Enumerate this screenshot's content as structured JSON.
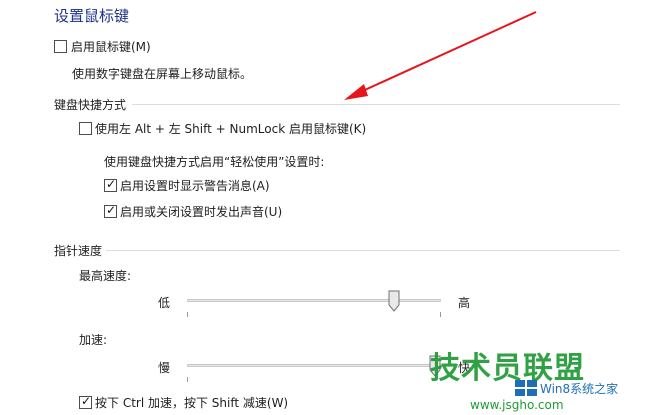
{
  "page": {
    "title": "设置鼠标键"
  },
  "mouse_keys": {
    "enable_label": "启用鼠标键(M)",
    "enable_checked": false,
    "description": "使用数字键盘在屏幕上移动鼠标。"
  },
  "shortcut": {
    "group_label": "键盘快捷方式",
    "hotkey_label": "使用左 Alt + 左 Shift + NumLock 启用鼠标键(K)",
    "hotkey_checked": false,
    "sub_label": "使用键盘快捷方式启用“轻松使用”设置时:",
    "warn_label": "启用设置时显示警告消息(A)",
    "warn_checked": true,
    "sound_label": "启用或关闭设置时发出声音(U)",
    "sound_checked": true
  },
  "pointer": {
    "group_label": "指针速度",
    "top_speed_label": "最高速度:",
    "top_speed_low": "低",
    "top_speed_high": "高",
    "top_speed_value": 0.83,
    "accel_label": "加速:",
    "accel_low": "慢",
    "accel_high": "快",
    "accel_value": 1.0,
    "ctrl_shift_label": "按下 Ctrl 加速，按下 Shift 减速(W)",
    "ctrl_shift_checked": true
  },
  "watermark": {
    "brand": "技术员联盟",
    "sub": "Win8系统之家",
    "url": "www.jsgho.com"
  },
  "colors": {
    "title": "#1e3287",
    "arrow": "#e8141b",
    "watermark_green": "#1f9a35"
  }
}
